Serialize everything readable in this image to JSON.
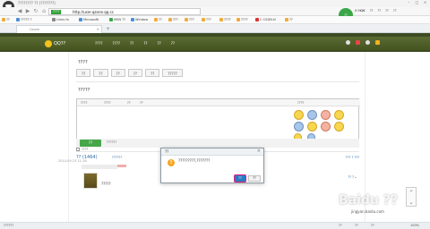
{
  "browser": {
    "title": "???????? ?? (???????)",
    "secure_label": "????",
    "url": "http://user.qzone.qq.cc",
    "speed_label": "??",
    "speed_value": "0.9K/s",
    "tools": [
      "??",
      "??",
      "??",
      "??",
      "??"
    ],
    "tab_title": "Qzone",
    "bookmarks": [
      "??",
      "????? ?",
      "Links fo",
      "Microsoftl",
      "MSN ??",
      "Window",
      "??",
      "???",
      "???",
      "???",
      "????",
      "????",
      "C CSDN.N",
      "??"
    ]
  },
  "qq": {
    "title": "QQ??",
    "nav": [
      "????",
      "????",
      "??",
      "??",
      "??",
      "??"
    ]
  },
  "friend_section": {
    "title": "????",
    "tags": [
      "??",
      "??",
      "??",
      "??",
      "??",
      "?????"
    ]
  },
  "compose": {
    "title": "?????",
    "toolbar": [
      "????",
      "????",
      "??",
      "??"
    ],
    "emoji_label": "????",
    "bottom_opts": [
      "????",
      "???"
    ],
    "publish_label": "??",
    "publish_opt": "??????"
  },
  "messages": {
    "title": "?? (1464)",
    "filter": "??????",
    "pagination": "??? ? ???",
    "flag": "?? ?",
    "item_text": "?????",
    "actions": "?? ??",
    "time": "2014-09-23 11:18"
  },
  "modal": {
    "title": "??",
    "message": "?????????,???????",
    "ok_label": "??",
    "cancel_label": "??",
    "warn_symbol": "!"
  },
  "watermark": {
    "brand": "Baidu ??",
    "url": "jingyan.baidu.com"
  },
  "status": {
    "left": "??????",
    "right": [
      "??",
      "??",
      "??",
      "100%"
    ]
  }
}
